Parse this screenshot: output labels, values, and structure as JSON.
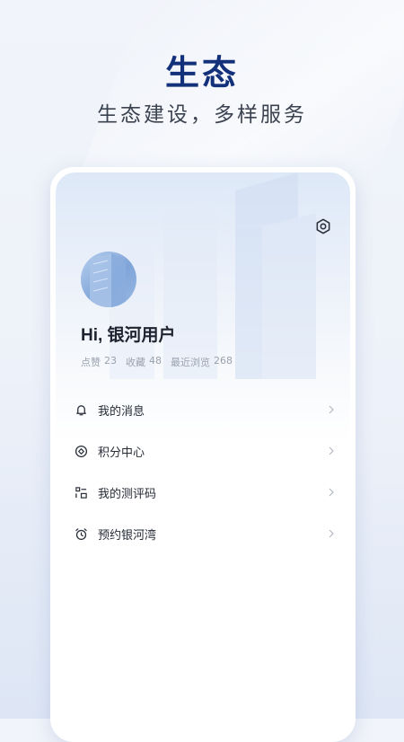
{
  "headline": "生态",
  "subline": "生态建设，多样服务",
  "profile": {
    "greeting": "Hi, 银河用户",
    "stats": [
      {
        "label": "点赞",
        "value": "23"
      },
      {
        "label": "收藏",
        "value": "48"
      },
      {
        "label": "最近浏览",
        "value": "268"
      }
    ]
  },
  "menu": [
    {
      "label": "我的消息",
      "icon": "bell-icon"
    },
    {
      "label": "积分中心",
      "icon": "points-icon"
    },
    {
      "label": "我的测评码",
      "icon": "code-icon"
    },
    {
      "label": "预约银河湾",
      "icon": "alarm-clock-icon"
    }
  ],
  "colors": {
    "headline": "#13307a",
    "accent": "#4f7fcf"
  }
}
